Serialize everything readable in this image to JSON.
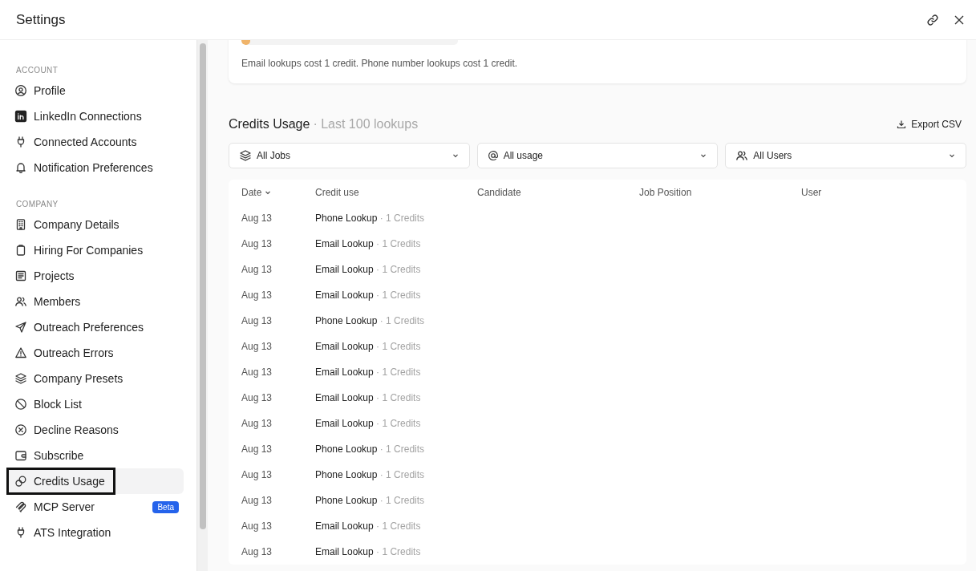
{
  "window": {
    "title": "Settings"
  },
  "sidebar": {
    "sections": [
      {
        "label": "ACCOUNT",
        "items": [
          {
            "label": "Profile",
            "selected": false
          },
          {
            "label": "LinkedIn Connections",
            "selected": false
          },
          {
            "label": "Connected Accounts",
            "selected": false
          },
          {
            "label": "Notification Preferences",
            "selected": false
          }
        ]
      },
      {
        "label": "COMPANY",
        "items": [
          {
            "label": "Company Details",
            "selected": false
          },
          {
            "label": "Hiring For Companies",
            "selected": false
          },
          {
            "label": "Projects",
            "selected": false
          },
          {
            "label": "Members",
            "selected": false
          },
          {
            "label": "Outreach Preferences",
            "selected": false
          },
          {
            "label": "Outreach Errors",
            "selected": false
          },
          {
            "label": "Company Presets",
            "selected": false
          },
          {
            "label": "Block List",
            "selected": false
          },
          {
            "label": "Decline Reasons",
            "selected": false
          },
          {
            "label": "Subscribe",
            "selected": false
          },
          {
            "label": "Credits Usage",
            "selected": true
          },
          {
            "label": "MCP Server",
            "selected": false,
            "badge": "Beta"
          },
          {
            "label": "ATS Integration",
            "selected": false
          }
        ]
      }
    ]
  },
  "credits_card": {
    "level": 0.04,
    "note": "Email lookups cost 1 credit. Phone number lookups cost 1 credit."
  },
  "usage": {
    "title": "Credits Usage",
    "subtitle": "· Last 100 lookups",
    "export": "Export CSV",
    "filters": [
      {
        "label": "All Jobs"
      },
      {
        "label": "All usage"
      },
      {
        "label": "All Users"
      }
    ],
    "columns": [
      "Date",
      "Credit use",
      "Candidate",
      "Job Position",
      "User"
    ],
    "rows": [
      {
        "date": "Aug 13",
        "use": "Phone Lookup",
        "credits": "· 1 Credits"
      },
      {
        "date": "Aug 13",
        "use": "Email Lookup",
        "credits": "· 1 Credits"
      },
      {
        "date": "Aug 13",
        "use": "Email Lookup",
        "credits": "· 1 Credits"
      },
      {
        "date": "Aug 13",
        "use": "Email Lookup",
        "credits": "· 1 Credits"
      },
      {
        "date": "Aug 13",
        "use": "Phone Lookup",
        "credits": "· 1 Credits"
      },
      {
        "date": "Aug 13",
        "use": "Email Lookup",
        "credits": "· 1 Credits"
      },
      {
        "date": "Aug 13",
        "use": "Email Lookup",
        "credits": "· 1 Credits"
      },
      {
        "date": "Aug 13",
        "use": "Email Lookup",
        "credits": "· 1 Credits"
      },
      {
        "date": "Aug 13",
        "use": "Email Lookup",
        "credits": "· 1 Credits"
      },
      {
        "date": "Aug 13",
        "use": "Phone Lookup",
        "credits": "· 1 Credits"
      },
      {
        "date": "Aug 13",
        "use": "Phone Lookup",
        "credits": "· 1 Credits"
      },
      {
        "date": "Aug 13",
        "use": "Phone Lookup",
        "credits": "· 1 Credits"
      },
      {
        "date": "Aug 13",
        "use": "Email Lookup",
        "credits": "· 1 Credits"
      },
      {
        "date": "Aug 13",
        "use": "Email Lookup",
        "credits": "· 1 Credits"
      }
    ]
  }
}
